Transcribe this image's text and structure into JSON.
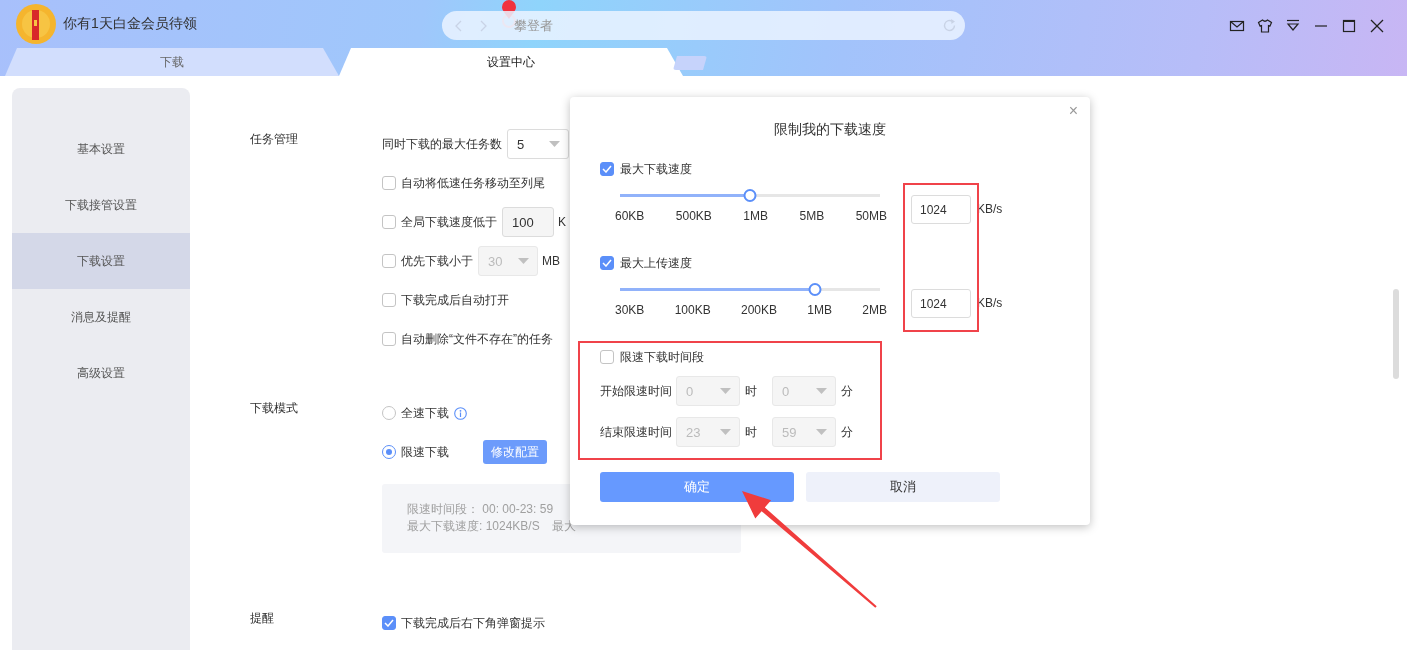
{
  "header": {
    "promo": "你有1天白金会员待领",
    "address": "攀登者"
  },
  "tabs": [
    {
      "label": "下载",
      "selected": false
    },
    {
      "label": "设置中心",
      "selected": true
    }
  ],
  "sidebar": {
    "items": [
      {
        "label": "基本设置",
        "selected": false
      },
      {
        "label": "下载接管设置",
        "selected": false
      },
      {
        "label": "下载设置",
        "selected": true
      },
      {
        "label": "消息及提醒",
        "selected": false
      },
      {
        "label": "高级设置",
        "selected": false
      }
    ]
  },
  "sections": [
    {
      "title": "任务管理",
      "rows": [
        {
          "kind": "select",
          "label": "同时下载的最大任务数",
          "value": "5",
          "disabled": false
        },
        {
          "kind": "checkbox",
          "label": "自动将低速任务移动至列尾",
          "checked": false
        },
        {
          "kind": "checkbox-input",
          "label": "全局下载速度低于",
          "value": "100",
          "suffix": "K",
          "checked": false
        },
        {
          "kind": "checkbox-select",
          "label": "优先下载小于",
          "value": "30",
          "disabled": true,
          "suffix": "MB",
          "checked": false
        },
        {
          "kind": "checkbox",
          "label": "下载完成后自动打开",
          "checked": false
        },
        {
          "kind": "checkbox",
          "label": "自动删除“文件不存在”的任务",
          "checked": false
        }
      ]
    },
    {
      "title": "下载模式",
      "rows": [
        {
          "kind": "radio",
          "label": "全速下载",
          "selected": false,
          "has_info": true
        },
        {
          "kind": "radio",
          "label": "限速下载",
          "selected": true,
          "button": "修改配置"
        },
        {
          "kind": "note",
          "lines": [
            [
              "限速时间段： 00: 00-23: 59"
            ],
            [
              "最大下载速度: 1024KB/S",
              "最大"
            ]
          ]
        }
      ]
    },
    {
      "title": "提醒",
      "rows": [
        {
          "kind": "checkbox",
          "label": "下载完成后右下角弹窗提示",
          "checked": true
        }
      ]
    }
  ],
  "dialog": {
    "title": "限制我的下载速度",
    "close": "×",
    "limits": [
      {
        "label": "最大下载速度",
        "checked": true,
        "level": 0.5,
        "ticks": [
          "60KB",
          "500KB",
          "1MB",
          "5MB",
          "50MB"
        ],
        "value": "1024",
        "unit": "KB/s"
      },
      {
        "label": "最大上传速度",
        "checked": true,
        "level": 0.75,
        "ticks": [
          "30KB",
          "100KB",
          "200KB",
          "1MB",
          "2MB"
        ],
        "value": "1024",
        "unit": "KB/s"
      }
    ],
    "schedule": {
      "label": "限速下载时间段",
      "checked": false,
      "rows": [
        {
          "label": "开始限速时间",
          "hour": "0",
          "hour_unit": "时",
          "minute": "0",
          "minute_unit": "分"
        },
        {
          "label": "结束限速时间",
          "hour": "23",
          "hour_unit": "时",
          "minute": "59",
          "minute_unit": "分"
        }
      ]
    },
    "buttons": [
      {
        "label": "确定",
        "kind": "primary"
      },
      {
        "label": "取消",
        "kind": "secondary"
      }
    ]
  }
}
